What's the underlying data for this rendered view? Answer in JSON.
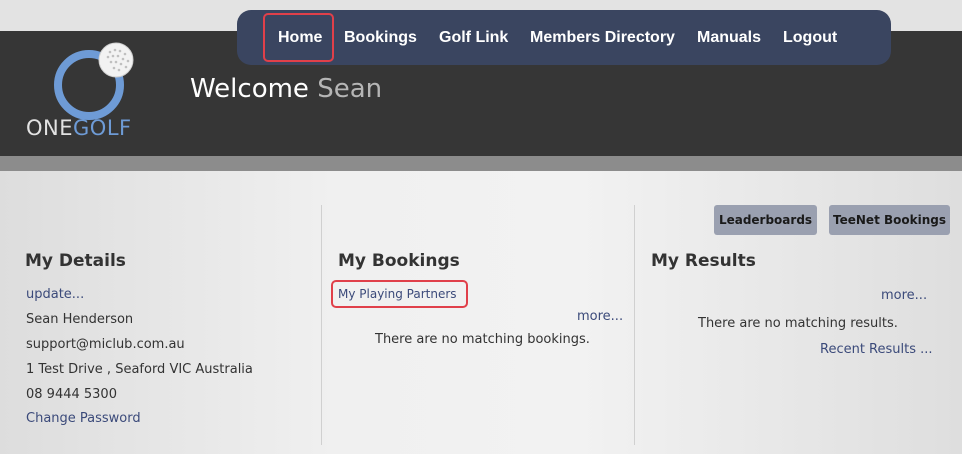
{
  "nav": {
    "home": "Home",
    "bookings": "Bookings",
    "golf_link": "Golf Link",
    "members_directory": "Members Directory",
    "manuals": "Manuals",
    "logout": "Logout"
  },
  "logo": {
    "one": "ONE",
    "golf": "GOLF"
  },
  "welcome": {
    "greeting": "Welcome",
    "name": "Sean"
  },
  "buttons": {
    "leaderboards": "Leaderboards",
    "teenet": "TeeNet Bookings"
  },
  "details": {
    "title": "My Details",
    "update": "update...",
    "name": "Sean Henderson",
    "email": "support@miclub.com.au",
    "address": "1 Test Drive , Seaford VIC Australia",
    "phone": "08 9444 5300",
    "change_password": "Change Password"
  },
  "bookings": {
    "title": "My Bookings",
    "playing_partners": "My Playing Partners",
    "more": "more...",
    "empty": "There are no matching bookings."
  },
  "results": {
    "title": "My Results",
    "more": "more...",
    "empty": "There are no matching results.",
    "recent": "Recent Results ..."
  },
  "colors": {
    "nav_bg": "#3a4560",
    "header_bg": "#363636",
    "highlight": "#e0404a",
    "logo_blue": "#6e9bd6"
  }
}
